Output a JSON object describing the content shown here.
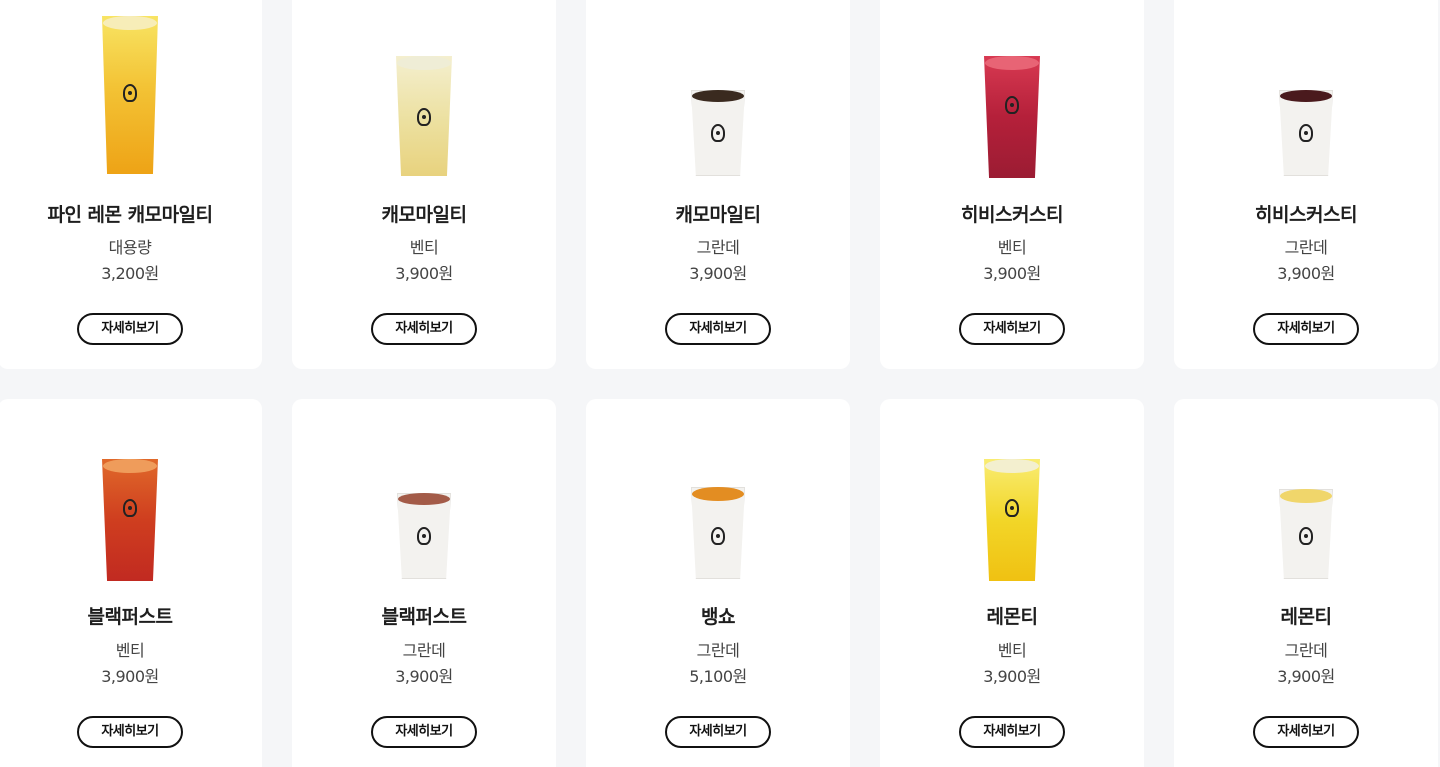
{
  "products": [
    {
      "name": "파인 레몬 캐모마일티",
      "size": "대용량",
      "price": "3,200원",
      "button": "자세히보기",
      "color": "#f2b51f"
    },
    {
      "name": "캐모마일티",
      "size": "벤티",
      "price": "3,900원",
      "button": "자세히보기",
      "color": "#eadca0"
    },
    {
      "name": "캐모마일티",
      "size": "그란데",
      "price": "3,900원",
      "button": "자세히보기",
      "color": "#f3f1ee"
    },
    {
      "name": "히비스커스티",
      "size": "벤티",
      "price": "3,900원",
      "button": "자세히보기",
      "color": "#b8253d"
    },
    {
      "name": "히비스커스티",
      "size": "그란데",
      "price": "3,900원",
      "button": "자세히보기",
      "color": "#f1f0ef"
    },
    {
      "name": "블랙퍼스트",
      "size": "벤티",
      "price": "3,900원",
      "button": "자세히보기",
      "color": "#c7401f"
    },
    {
      "name": "블랙퍼스트",
      "size": "그란데",
      "price": "3,900원",
      "button": "자세히보기",
      "color": "#f3f1ee"
    },
    {
      "name": "뱅쇼",
      "size": "그란데",
      "price": "5,100원",
      "button": "자세히보기",
      "color": "#f1f0ef"
    },
    {
      "name": "레몬티",
      "size": "벤티",
      "price": "3,900원",
      "button": "자세히보기",
      "color": "#f0d12a"
    },
    {
      "name": "레몬티",
      "size": "그란데",
      "price": "3,900원",
      "button": "자세히보기",
      "color": "#f2f0ee"
    }
  ]
}
